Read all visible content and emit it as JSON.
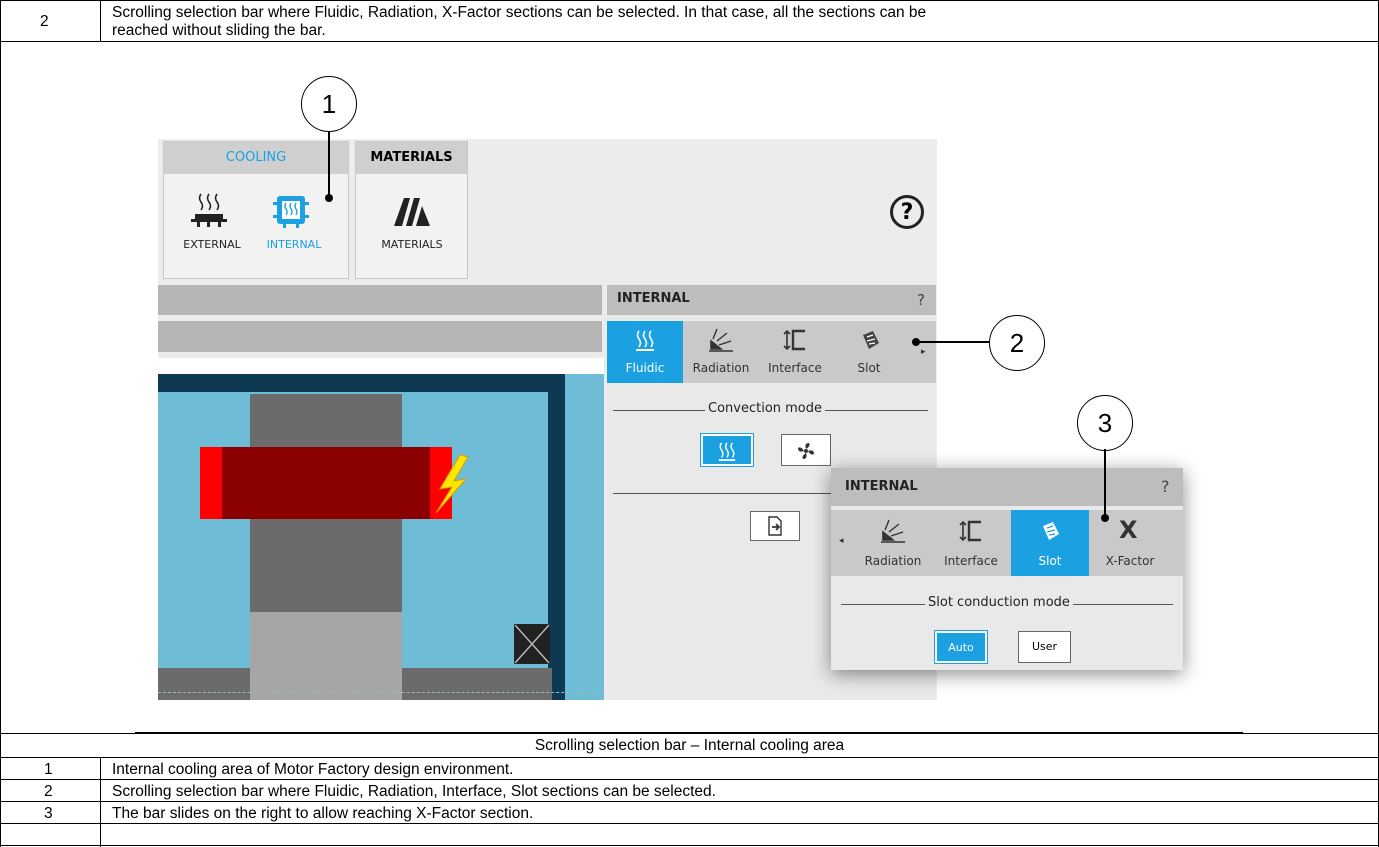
{
  "top_row": {
    "number": "2",
    "text_line1": "Scrolling selection bar where Fluidic, Radiation, X-Factor sections can be selected. In that case, all the sections can be",
    "text_line2": "reached without sliding the bar."
  },
  "figure": {
    "ribbon": {
      "cooling_tab": "COOLING",
      "materials_tab": "MATERIALS",
      "external_label": "EXTERNAL",
      "internal_label": "INTERNAL",
      "materials_label": "MATERIALS",
      "help_symbol": "?"
    },
    "panel_main": {
      "title": "INTERNAL",
      "help_symbol": "?",
      "tabs": [
        "Fluidic",
        "Radiation",
        "Interface",
        "Slot"
      ],
      "section_label": "Convection mode"
    },
    "panel_popup": {
      "title": "INTERNAL",
      "help_symbol": "?",
      "tabs": [
        "Radiation",
        "Interface",
        "Slot",
        "X-Factor"
      ],
      "section_label": "Slot conduction mode",
      "auto_button": "Auto",
      "user_button": "User"
    },
    "callouts": [
      "1",
      "2",
      "3"
    ],
    "colors": {
      "accent_blue": "#1ba1e2",
      "motor_blue": "#6fbcd6",
      "dark_frame": "#0d3a52",
      "winding_dark_red": "#8b0000",
      "winding_red": "#ff0000",
      "steel_gray": "#6b6b6b",
      "light_gray": "#a6a6a6",
      "lightning_yellow": "#ffe600"
    }
  },
  "caption": "Scrolling selection bar – Internal cooling area",
  "legend": [
    {
      "number": "1",
      "text": "Internal cooling area of Motor Factory design environment."
    },
    {
      "number": "2",
      "text": "Scrolling selection bar where Fluidic, Radiation, Interface, Slot sections can be selected."
    },
    {
      "number": "3",
      "text": "The bar slides on the right to allow reaching X-Factor section."
    }
  ]
}
